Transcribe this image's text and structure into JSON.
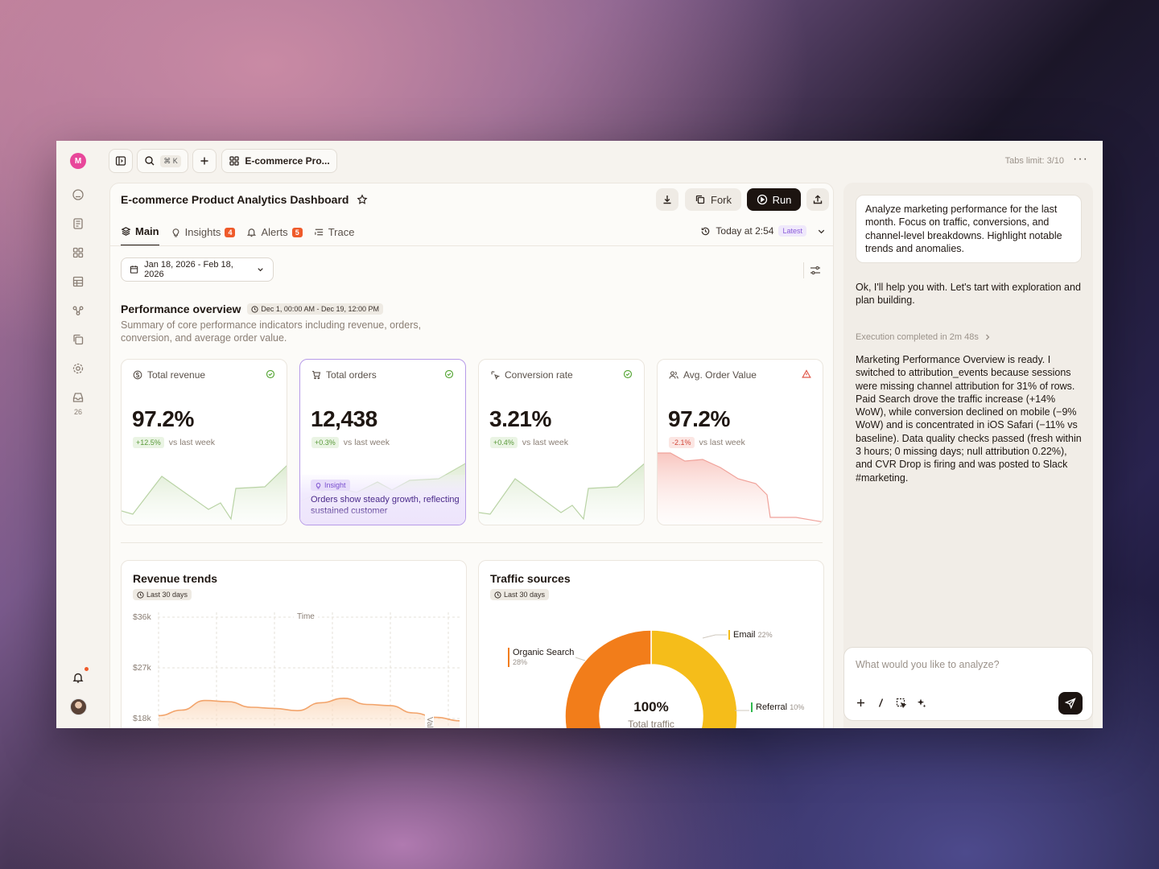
{
  "workspace": {
    "avatar_letter": "M",
    "inbox_count": "26"
  },
  "topbar": {
    "search_shortcut": "⌘ K",
    "tab_label": "E-commerce Pro...",
    "tabs_limit": "Tabs limit: 3/10"
  },
  "dashboard": {
    "title": "E-commerce Product Analytics Dashboard",
    "actions": {
      "fork": "Fork",
      "run": "Run"
    },
    "tabs": [
      {
        "label": "Main"
      },
      {
        "label": "Insights",
        "badge": "4"
      },
      {
        "label": "Alerts",
        "badge": "5"
      },
      {
        "label": "Trace"
      }
    ],
    "run_time": "Today at 2:54",
    "run_tag": "Latest",
    "date_range": "Jan 18, 2026 - Feb 18, 2026"
  },
  "overview": {
    "title": "Performance overview",
    "range_chip": "Dec 1, 00:00 AM - Dec 19, 12:00 PM",
    "description": "Summary of core performance indicators including revenue, orders, conversion, and average order value."
  },
  "kpis": [
    {
      "label": "Total revenue",
      "value": "97.2%",
      "delta": "+12.5%",
      "compare": "vs last week",
      "status": "ok",
      "accent": "#7bb35a"
    },
    {
      "label": "Total orders",
      "value": "12,438",
      "delta": "+0.3%",
      "compare": "vs last week",
      "status": "ok",
      "accent": "#7bb35a",
      "insight": {
        "tag": "Insight",
        "text": "Orders show steady growth, reflecting sustained customer"
      }
    },
    {
      "label": "Conversion rate",
      "value": "3.21%",
      "delta": "+0.4%",
      "compare": "vs last week",
      "status": "ok",
      "accent": "#7bb35a"
    },
    {
      "label": "Avg. Order Value",
      "value": "97.2%",
      "delta": "-2.1%",
      "compare": "vs last week",
      "status": "warning",
      "accent": "#e0584a"
    }
  ],
  "revenue_trends": {
    "title": "Revenue trends",
    "chip": "Last 30 days",
    "y_ticks": [
      "$36k",
      "$27k",
      "$18k"
    ],
    "x_axis_label": "Time",
    "y_axis_label": "Value"
  },
  "traffic_sources": {
    "title": "Traffic sources",
    "chip": "Last 30 days",
    "center_value": "100%",
    "center_label": "Total traffic",
    "slices": [
      {
        "name": "Email",
        "pct": "22%",
        "value": 22,
        "color": "#f5bd1a"
      },
      {
        "name": "Referral",
        "pct": "10%",
        "value": 10,
        "color": "#2fb84e"
      },
      {
        "name": "Organic Search",
        "pct": "28%",
        "value": 28,
        "color": "#f27d1a"
      }
    ]
  },
  "chat": {
    "prompt": "Analyze marketing performance for the last month. Focus on traffic, conversions, and channel-level breakdowns. Highlight notable trends and anomalies.",
    "reply": "Ok, I'll help you with. Let's tart with exploration and plan building.",
    "execution": "Execution completed in 2m 48s",
    "summary": "Marketing Performance Overview is ready. I switched to attribution_events because sessions were missing channel attribution for 31% of rows. Paid Search drove the traffic increase (+14% WoW), while conversion declined on mobile (−9% WoW) and is concentrated in iOS Safari (−11% vs baseline). Data quality checks passed (fresh within 3 hours; 0 missing days; null attribution 0.22%), and CVR Drop is firing and was posted to Slack #marketing.",
    "placeholder": "What would you like to analyze?"
  },
  "chart_data": [
    {
      "type": "line",
      "title": "Revenue trends",
      "ylabel": "Value",
      "xlabel": "Time",
      "y_ticks": [
        "$36k",
        "$27k",
        "$18k"
      ],
      "series": [
        {
          "values": [
            18.5,
            19.5,
            21.2,
            21.0,
            20.0,
            19.8,
            19.4,
            20.8,
            21.6,
            20.5,
            20.3,
            19.0,
            18.2,
            17.6
          ]
        }
      ]
    },
    {
      "type": "pie",
      "title": "Traffic sources",
      "categories": [
        "Email",
        "Referral",
        "Organic Search"
      ],
      "values": [
        22,
        10,
        28
      ]
    }
  ]
}
